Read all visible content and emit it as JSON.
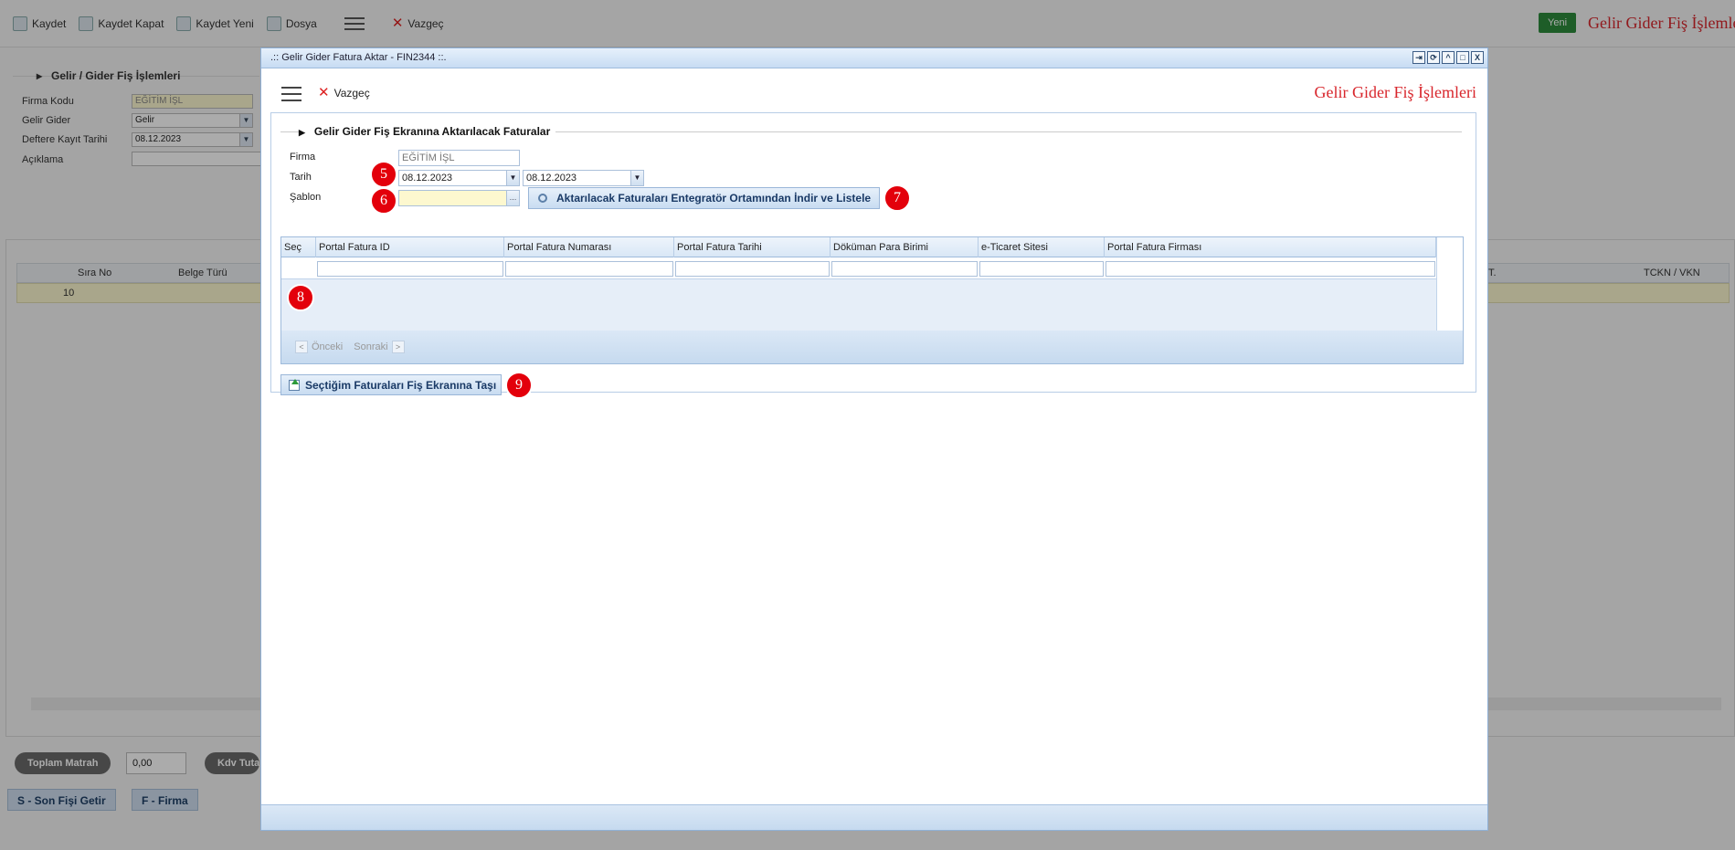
{
  "background": {
    "toolbar": [
      {
        "label": "Kaydet",
        "icon": "save-icon"
      },
      {
        "label": "Kaydet Kapat",
        "icon": "save-close-icon"
      },
      {
        "label": "Kaydet Yeni",
        "icon": "save-new-icon"
      },
      {
        "label": "Dosya",
        "icon": "file-icon"
      }
    ],
    "vazgec": "Vazgeç",
    "yeni": "Yeni",
    "page_title": "Gelir Gider Fiş İşlemleri",
    "section_title": "Gelir / Gider Fiş İşlemleri",
    "form": {
      "firma_kodu_label": "Firma Kodu",
      "firma_kodu_value": "EĞİTİM İŞL",
      "gelir_gider_label": "Gelir Gider",
      "gelir_gider_value": "Gelir",
      "kayit_tarihi_label": "Deftere Kayıt Tarihi",
      "kayit_tarihi_value": "08.12.2023",
      "aciklama_label": "Açıklama"
    },
    "grid": {
      "col_sira_no": "Sıra No",
      "col_belge_turu": "Belge Türü",
      "col_t": "T.",
      "col_tckn": "TCKN / VKN",
      "row_sira_no": "10"
    },
    "totals": {
      "toplam_matrah_label": "Toplam Matrah",
      "toplam_matrah_value": "0,00",
      "kdv_label": "Kdv Tuta"
    },
    "buttons": {
      "son_fis": "S - Son Fişi Getir",
      "firma": "F - Firma"
    }
  },
  "modal": {
    "window_title": ".:: Gelir Gider Fatura Aktar - FIN2344 ::.",
    "vazgec": "Vazgeç",
    "title": "Gelir Gider Fiş İşlemleri",
    "section_title": "Gelir Gider Fiş Ekranına Aktarılacak Faturalar",
    "firma_label": "Firma",
    "firma_value": "EĞİTİM İŞL",
    "tarih_label": "Tarih",
    "tarih_start": "08.12.2023",
    "tarih_end": "08.12.2023",
    "sablon_label": "Şablon",
    "sablon_value": "",
    "list_button": "Aktarılacak Faturaları Entegratör Ortamından İndir ve Listele",
    "grid": {
      "columns": [
        "Seç",
        "Portal Fatura ID",
        "Portal Fatura Numarası",
        "Portal Fatura Tarihi",
        "Döküman Para Birimi",
        "e-Ticaret Sitesi",
        "Portal Fatura Firması"
      ]
    },
    "pager": {
      "prev": "Önceki",
      "next": "Sonraki"
    },
    "move_button": "Seçtiğim Faturaları Fiş Ekranına Taşı",
    "badges": [
      "5",
      "6",
      "7",
      "8",
      "9"
    ]
  }
}
